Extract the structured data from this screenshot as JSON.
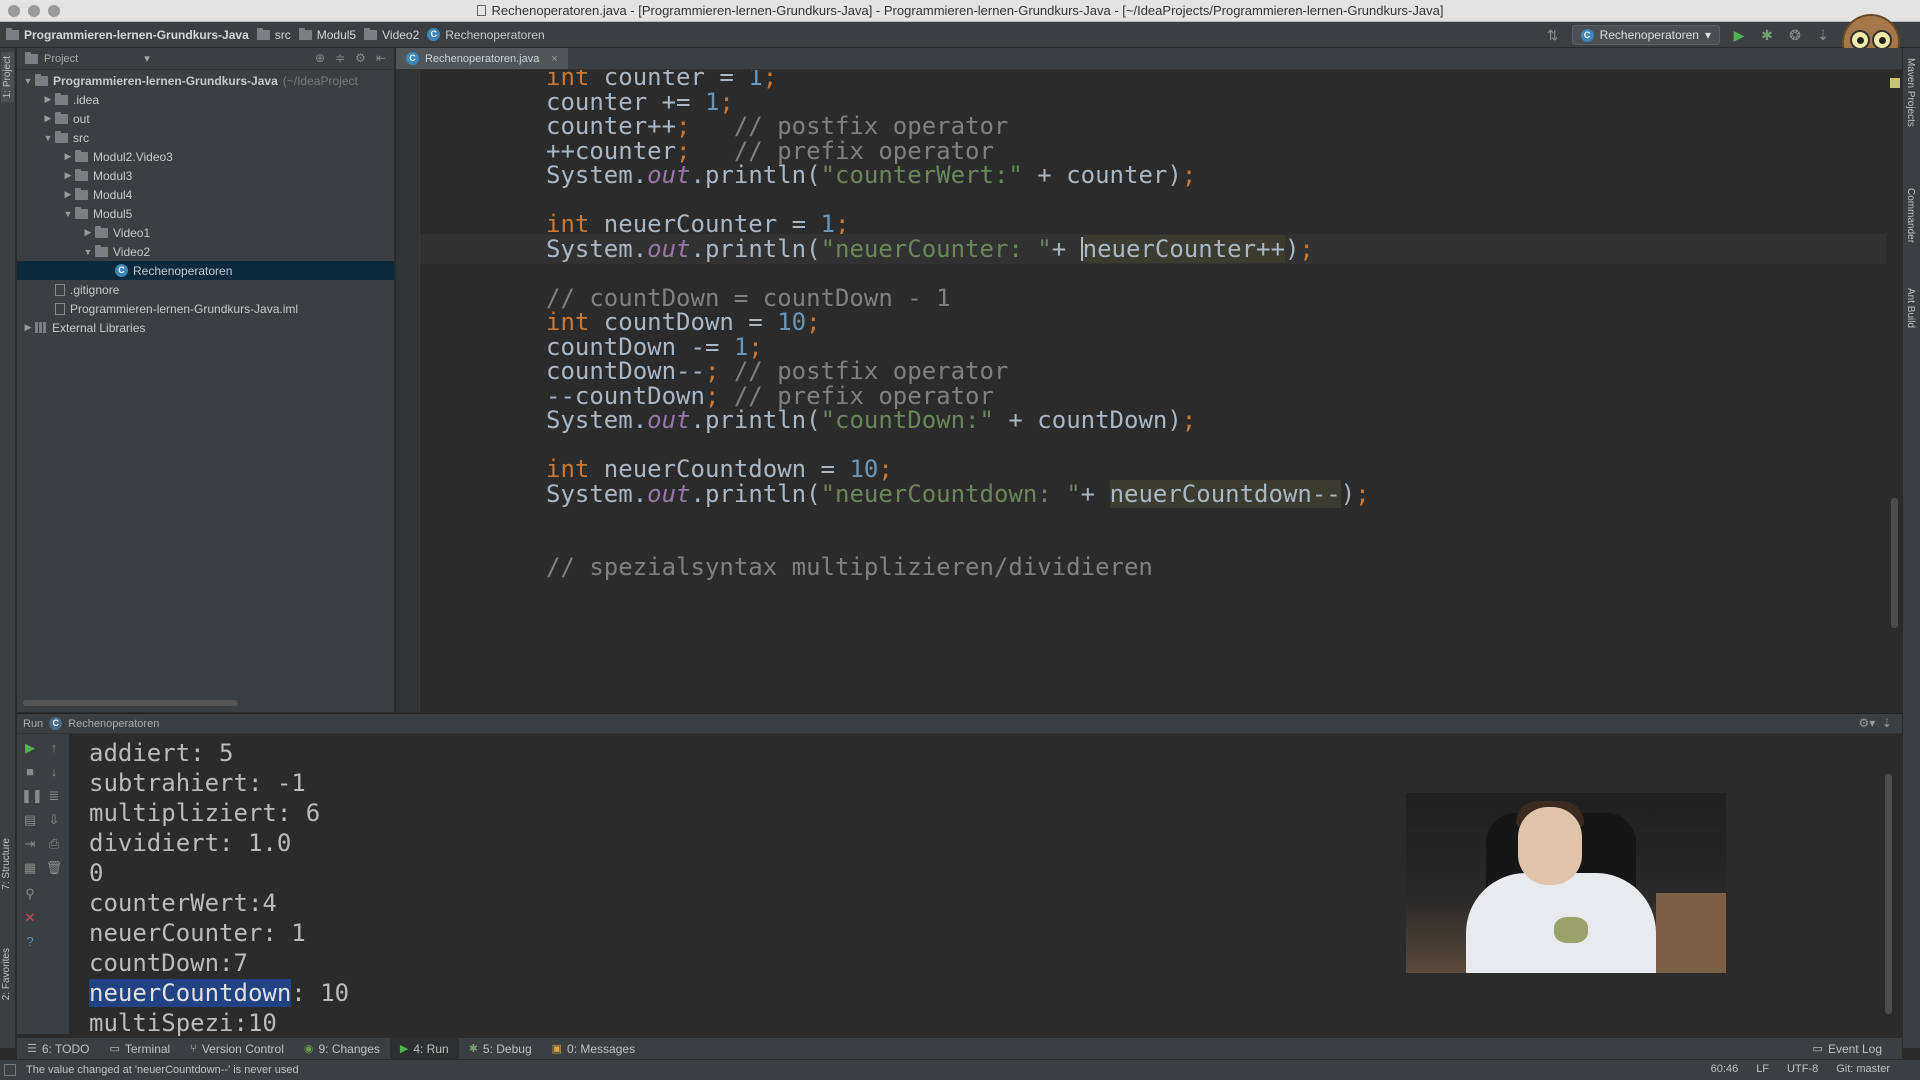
{
  "window": {
    "title": "Rechenoperatoren.java - [Programmieren-lernen-Grundkurs-Java] - Programmieren-lernen-Grundkurs-Java - [~/IdeaProjects/Programmieren-lernen-Grundkurs-Java]"
  },
  "breadcrumbs": [
    "Programmieren-lernen-Grundkurs-Java",
    "src",
    "Modul5",
    "Video2",
    "Rechenoperatoren"
  ],
  "run_config": {
    "label": "Rechenoperatoren"
  },
  "toolbar_icons": [
    "run-icon",
    "debug-icon",
    "coverage-icon",
    "vcs-update-icon",
    "vcs-commit-icon"
  ],
  "left_tabs": [
    "1: Project",
    "7: Structure",
    "2: Favorites"
  ],
  "right_tabs": [
    "Maven Projects",
    "Commander",
    "Ant Build"
  ],
  "project_panel": {
    "title": "Project",
    "tree": [
      {
        "label": "Programmieren-lernen-Grundkurs-Java",
        "hint": "(~/IdeaProject",
        "depth": 0,
        "arrow": "down",
        "icon": "folder",
        "bold": true
      },
      {
        "label": ".idea",
        "depth": 1,
        "arrow": "right",
        "icon": "folder"
      },
      {
        "label": "out",
        "depth": 1,
        "arrow": "right",
        "icon": "folder"
      },
      {
        "label": "src",
        "depth": 1,
        "arrow": "down",
        "icon": "folder"
      },
      {
        "label": "Modul2.Video3",
        "depth": 2,
        "arrow": "right",
        "icon": "folder"
      },
      {
        "label": "Modul3",
        "depth": 2,
        "arrow": "right",
        "icon": "folder"
      },
      {
        "label": "Modul4",
        "depth": 2,
        "arrow": "right",
        "icon": "folder"
      },
      {
        "label": "Modul5",
        "depth": 2,
        "arrow": "down",
        "icon": "folder"
      },
      {
        "label": "Video1",
        "depth": 3,
        "arrow": "right",
        "icon": "folder"
      },
      {
        "label": "Video2",
        "depth": 3,
        "arrow": "down",
        "icon": "folder"
      },
      {
        "label": "Rechenoperatoren",
        "depth": 4,
        "arrow": "none",
        "icon": "class",
        "selected": true
      },
      {
        "label": ".gitignore",
        "depth": 1,
        "arrow": "none",
        "icon": "file"
      },
      {
        "label": "Programmieren-lernen-Grundkurs-Java.iml",
        "depth": 1,
        "arrow": "none",
        "icon": "file"
      },
      {
        "label": "External Libraries",
        "depth": 0,
        "arrow": "right",
        "icon": "library"
      }
    ]
  },
  "editor": {
    "tab": {
      "label": "Rechenoperatoren.java",
      "close": "×"
    },
    "lines": [
      [
        [
          "kw",
          "int "
        ],
        [
          "t",
          "counter = "
        ],
        [
          "num",
          "1"
        ],
        [
          "kw",
          ";"
        ]
      ],
      [
        [
          "t",
          "counter += "
        ],
        [
          "num",
          "1"
        ],
        [
          "kw",
          ";"
        ]
      ],
      [
        [
          "t",
          "counter++"
        ],
        [
          "kw",
          ";"
        ],
        [
          "cm",
          "   // postfix operator"
        ]
      ],
      [
        [
          "t",
          "++counter"
        ],
        [
          "kw",
          ";"
        ],
        [
          "cm",
          "   // prefix operator"
        ]
      ],
      [
        [
          "t",
          "System."
        ],
        [
          "fld",
          "out"
        ],
        [
          "t",
          ".println("
        ],
        [
          "str",
          "\"counterWert:\""
        ],
        [
          "t",
          " + counter)"
        ],
        [
          "kw",
          ";"
        ]
      ],
      [],
      [
        [
          "kw",
          "int "
        ],
        [
          "t",
          "neuerCounter = "
        ],
        [
          "num",
          "1"
        ],
        [
          "kw",
          ";"
        ]
      ],
      [
        [
          "t",
          "System."
        ],
        [
          "fld",
          "out"
        ],
        [
          "t",
          ".println("
        ],
        [
          "str",
          "\"neuerCounter: \""
        ],
        [
          "t",
          "+ "
        ],
        [
          "caret",
          ""
        ],
        [
          "hl",
          "neuerCounter++"
        ],
        [
          "t",
          ")"
        ],
        [
          "kw",
          ";"
        ]
      ],
      [],
      [
        [
          "cm",
          "// countDown = countDown - 1"
        ]
      ],
      [
        [
          "kw",
          "int "
        ],
        [
          "t",
          "countDown = "
        ],
        [
          "num",
          "10"
        ],
        [
          "kw",
          ";"
        ]
      ],
      [
        [
          "t",
          "countDown -= "
        ],
        [
          "num",
          "1"
        ],
        [
          "kw",
          ";"
        ]
      ],
      [
        [
          "t",
          "countDown--"
        ],
        [
          "kw",
          ";"
        ],
        [
          "cm",
          " // postfix operator"
        ]
      ],
      [
        [
          "t",
          "--countDown"
        ],
        [
          "kw",
          ";"
        ],
        [
          "cm",
          " // prefix operator"
        ]
      ],
      [
        [
          "t",
          "System."
        ],
        [
          "fld",
          "out"
        ],
        [
          "t",
          ".println("
        ],
        [
          "str",
          "\"countDown:\""
        ],
        [
          "t",
          " + countDown)"
        ],
        [
          "kw",
          ";"
        ]
      ],
      [],
      [
        [
          "kw",
          "int "
        ],
        [
          "t",
          "neuerCountdown = "
        ],
        [
          "num",
          "10"
        ],
        [
          "kw",
          ";"
        ]
      ],
      [
        [
          "t",
          "System."
        ],
        [
          "fld",
          "out"
        ],
        [
          "t",
          ".println("
        ],
        [
          "str",
          "\"neuerCountdown: \""
        ],
        [
          "t",
          "+ "
        ],
        [
          "hl",
          "neuerCountdown--"
        ],
        [
          "t",
          ")"
        ],
        [
          "kw",
          ";"
        ]
      ],
      [],
      [],
      [
        [
          "cm",
          "// spezialsyntax multiplizieren/dividieren"
        ]
      ]
    ],
    "current_line_index": 7
  },
  "run_panel": {
    "title": "Run",
    "config": "Rechenoperatoren",
    "output": [
      "addiert: 5",
      "subtrahiert: -1",
      "multipliziert: 6",
      "dividiert: 1.0",
      "0",
      "counterWert:4",
      "neuerCounter: 1",
      "countDown:7",
      "neuerCountdown: 10",
      "multiSpezi:10"
    ],
    "selection": {
      "line_index": 8,
      "text": "neuerCountdown"
    }
  },
  "bottom_tools": [
    {
      "label": "6: TODO",
      "icon": "todo-icon"
    },
    {
      "label": "Terminal",
      "icon": "terminal-icon"
    },
    {
      "label": "Version Control",
      "icon": "version-control-icon"
    },
    {
      "label": "9: Changes",
      "icon": "changes-icon"
    },
    {
      "label": "4: Run",
      "icon": "run-icon",
      "active": true
    },
    {
      "label": "5: Debug",
      "icon": "debug-icon"
    },
    {
      "label": "0: Messages",
      "icon": "messages-icon"
    }
  ],
  "event_log": "Event Log",
  "status": {
    "message": "The value changed at 'neuerCountdown--' is never used",
    "position": "60:46",
    "line_sep": "LF",
    "encoding": "UTF-8",
    "git": "Git: master"
  },
  "colors": {
    "keyword": "#cc7832",
    "number": "#6897bb",
    "string": "#6a8759",
    "field": "#9876aa",
    "comment": "#808080",
    "text": "#a9b7c6",
    "selection": "#214283"
  }
}
